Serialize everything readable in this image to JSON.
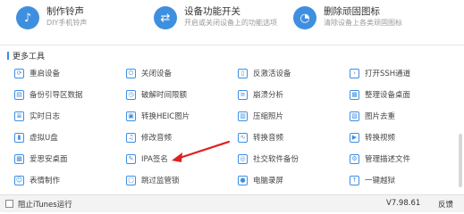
{
  "features": [
    {
      "title": "制作铃声",
      "subtitle": "DIY手机铃声",
      "icon": "bell-icon"
    },
    {
      "title": "设备功能开关",
      "subtitle": "开启或关闭设备上的功能选项",
      "icon": "toggle-icon"
    },
    {
      "title": "删除顽固图标",
      "subtitle": "清除设备上各类顽固图标",
      "icon": "pie-icon"
    }
  ],
  "section_title": "更多工具",
  "tools": [
    [
      "重启设备",
      "关闭设备",
      "反激活设备",
      "打开SSH通道"
    ],
    [
      "备份引导区数据",
      "破解时间限额",
      "崩溃分析",
      "整理设备桌面"
    ],
    [
      "实时日志",
      "转换HEIC图片",
      "压缩照片",
      "图片去重"
    ],
    [
      "虚拟U盘",
      "修改音频",
      "转换音频",
      "转换视频"
    ],
    [
      "爱思安桌面",
      "IPA签名",
      "社交软件备份",
      "管理描述文件"
    ],
    [
      "表情制作",
      "跳过监管锁",
      "电脑录屏",
      "一键越狱"
    ]
  ],
  "footer": {
    "checkbox_label": "阻止iTunes运行",
    "version": "V7.98.61",
    "feedback": "反馈"
  },
  "colors": {
    "accent": "#3f8fe0",
    "arrow": "#e02020"
  }
}
